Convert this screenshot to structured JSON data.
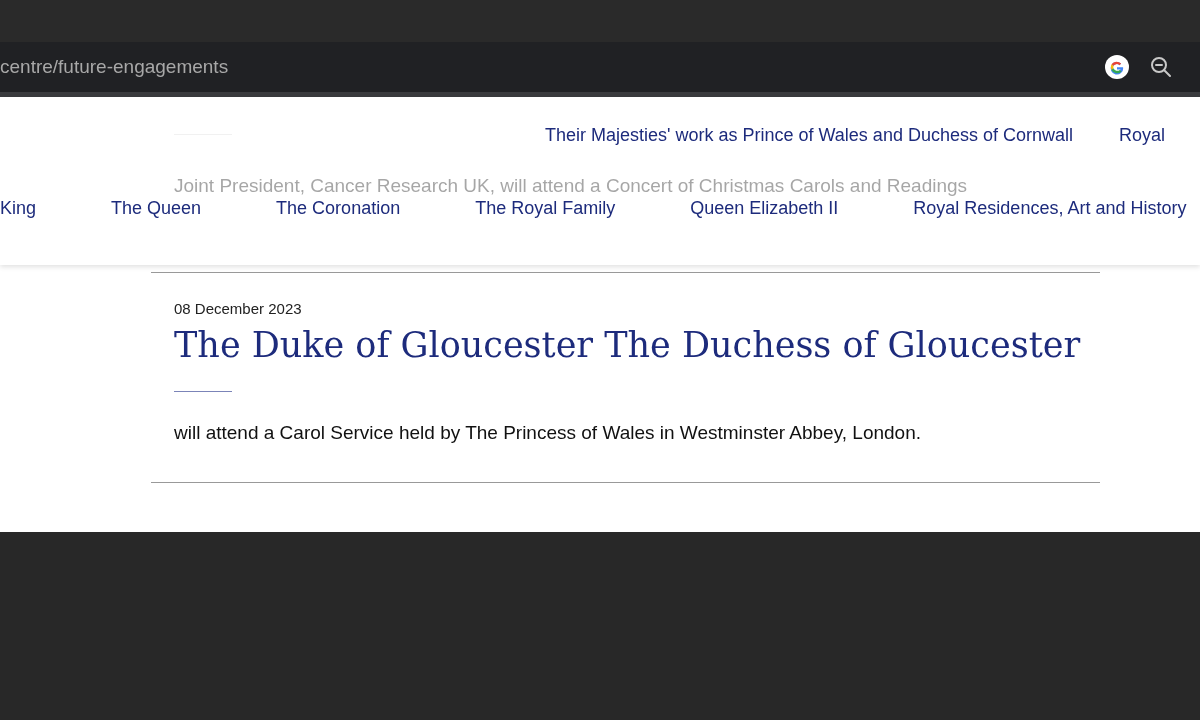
{
  "browser": {
    "url": "centre/future-engagements"
  },
  "nav": {
    "top_links": [
      "Their Majesties' work as Prince of Wales and Duchess of Cornwall",
      "Royal"
    ],
    "main_links": [
      "King",
      "The Queen",
      "The Coronation",
      "The Royal Family",
      "Queen Elizabeth II",
      "Royal Residences, Art and History"
    ]
  },
  "previous_entry": {
    "description": "Joint President, Cancer Research UK, will attend a Concert of Christmas Carols and Readings"
  },
  "engagement": {
    "date": "08 December 2023",
    "title": "The Duke of Gloucester The Duchess of Gloucester",
    "description": "will attend a Carol Service held by The Princess of Wales in Westminster Abbey, London."
  }
}
